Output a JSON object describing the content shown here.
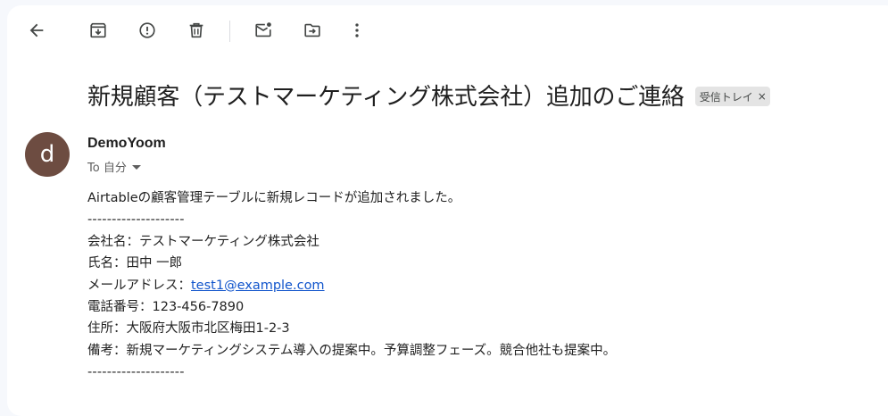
{
  "toolbar": {
    "back": "back-arrow",
    "archive": "archive",
    "spam": "report-spam",
    "delete": "delete",
    "mark_unread": "mark-unread",
    "move_to": "move-to",
    "more": "more-options"
  },
  "email": {
    "subject": "新規顧客（テストマーケティング株式会社）追加のご連絡",
    "label": "受信トレイ",
    "label_close": "×",
    "avatar_letter": "d",
    "avatar_color": "#6d4c41",
    "sender": "DemoYoom",
    "recipient": "To 自分",
    "body": {
      "intro": "Airtableの顧客管理テーブルに新規レコードが追加されました。",
      "separator": "--------------------",
      "company": "会社名：テストマーケティング株式会社",
      "name": "氏名：田中 一郎",
      "email_label": "メールアドレス：",
      "email_value": "test1@example.com",
      "phone": "電話番号：123-456-7890",
      "address": "住所：大阪府大阪市北区梅田1-2-3",
      "notes": "備考：新規マーケティングシステム導入の提案中。予算調整フェーズ。競合他社も提案中。",
      "separator_end": "--------------------"
    }
  }
}
